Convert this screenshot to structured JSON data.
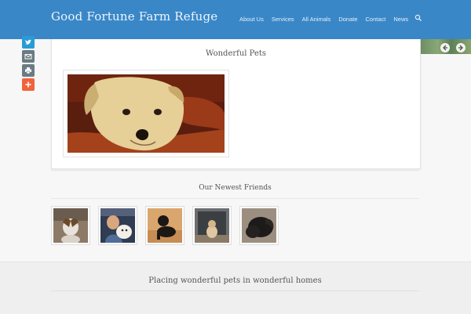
{
  "header": {
    "site_title": "Good Fortune Farm Refuge",
    "nav": [
      "About Us",
      "Services",
      "All Animals",
      "Donate",
      "Contact",
      "News"
    ],
    "colors": {
      "bar": "#3a87c8",
      "text": "#eef5fb"
    }
  },
  "share_icons": [
    "twitter-icon",
    "email-icon",
    "print-icon",
    "add-icon"
  ],
  "main": {
    "title": "Wonderful Pets"
  },
  "friends": {
    "title": "Our Newest Friends"
  },
  "footer": {
    "title": "Placing wonderful pets in wonderful homes"
  }
}
